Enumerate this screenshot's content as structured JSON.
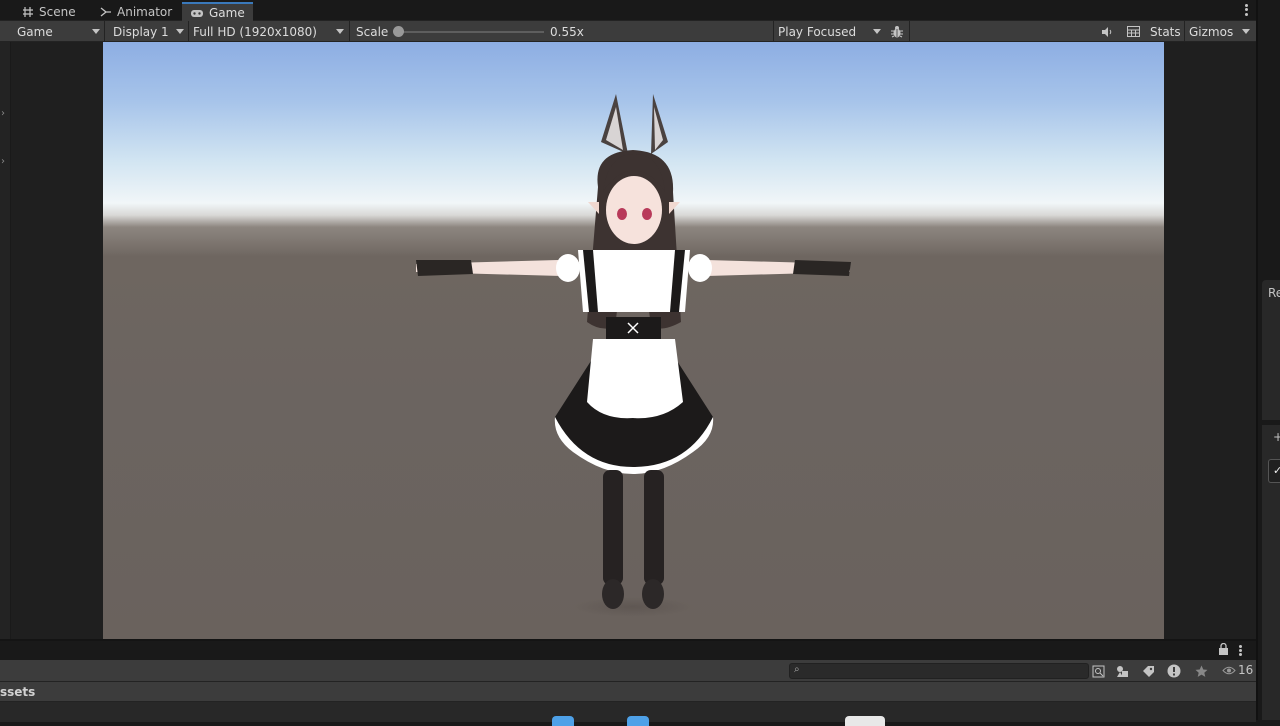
{
  "tabs": [
    {
      "label": "Scene",
      "icon": "grid-icon"
    },
    {
      "label": "Animator",
      "icon": "animator-icon"
    },
    {
      "label": "Game",
      "icon": "gamepad-icon",
      "active": true
    }
  ],
  "toolbar": {
    "view_mode": "Game",
    "display": "Display 1",
    "resolution": "Full HD (1920x1080)",
    "scale_label": "Scale",
    "scale_value": "0.55x",
    "scale_level": 0.0,
    "play_mode": "Play Focused",
    "stats_label": "Stats",
    "gizmos_label": "Gizmos"
  },
  "right_panel": {
    "label": "Re",
    "plus": "+",
    "check": "✓"
  },
  "bottom_panel": {
    "breadcrumb": "ssets",
    "search_placeholder": "",
    "hidden_count": "16"
  },
  "colors": {
    "accent": "#3a79bb",
    "panel": "#3c3c3c",
    "background": "#191919",
    "sky_top": "#8daee3",
    "ground": "#6b6460"
  }
}
